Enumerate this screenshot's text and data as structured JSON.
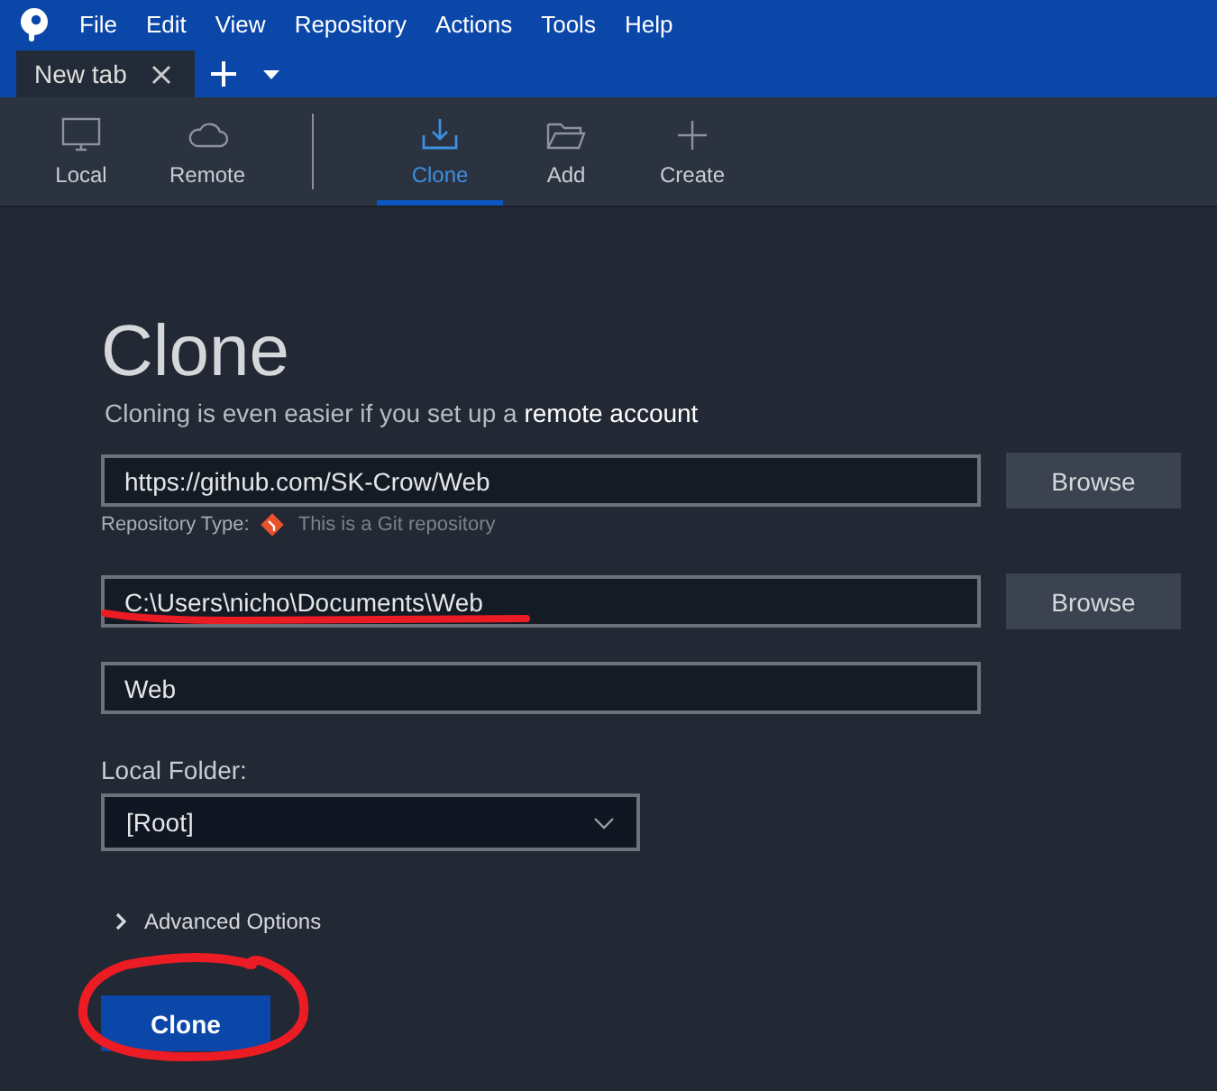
{
  "menu": [
    "File",
    "Edit",
    "View",
    "Repository",
    "Actions",
    "Tools",
    "Help"
  ],
  "tabs": [
    {
      "label": "New tab",
      "selected": true
    }
  ],
  "toolbar": {
    "sources": [
      {
        "kind": "local",
        "label": "Local",
        "selected": false
      },
      {
        "kind": "remote",
        "label": "Remote",
        "selected": false
      }
    ],
    "actions": [
      {
        "kind": "clone",
        "label": "Clone",
        "selected": true
      },
      {
        "kind": "add",
        "label": "Add",
        "selected": false
      },
      {
        "kind": "create",
        "label": "Create",
        "selected": false
      }
    ]
  },
  "form": {
    "title": "Clone",
    "subtitle": "Cloning is even easier if you set up a",
    "subtitle_link": "remote account",
    "source_url": "https://github.com/SK-Crow/Web",
    "browse_source": "Browse",
    "repo_type_label": "Repository Type:",
    "repo_type": "This is a Git repository",
    "destination": "C:\\Users\\nicho\\Documents\\Web",
    "destination_annotation": {
      "kind": "underline"
    },
    "browse_destination": "Browse",
    "name": "Web",
    "local_folder_label": "Local Folder:",
    "local_folder": "[Root]",
    "advanced": {
      "label": "Advanced Options",
      "expanded": false
    },
    "clone_button": "Clone",
    "clone_annotation": {
      "kind": "circle"
    }
  }
}
